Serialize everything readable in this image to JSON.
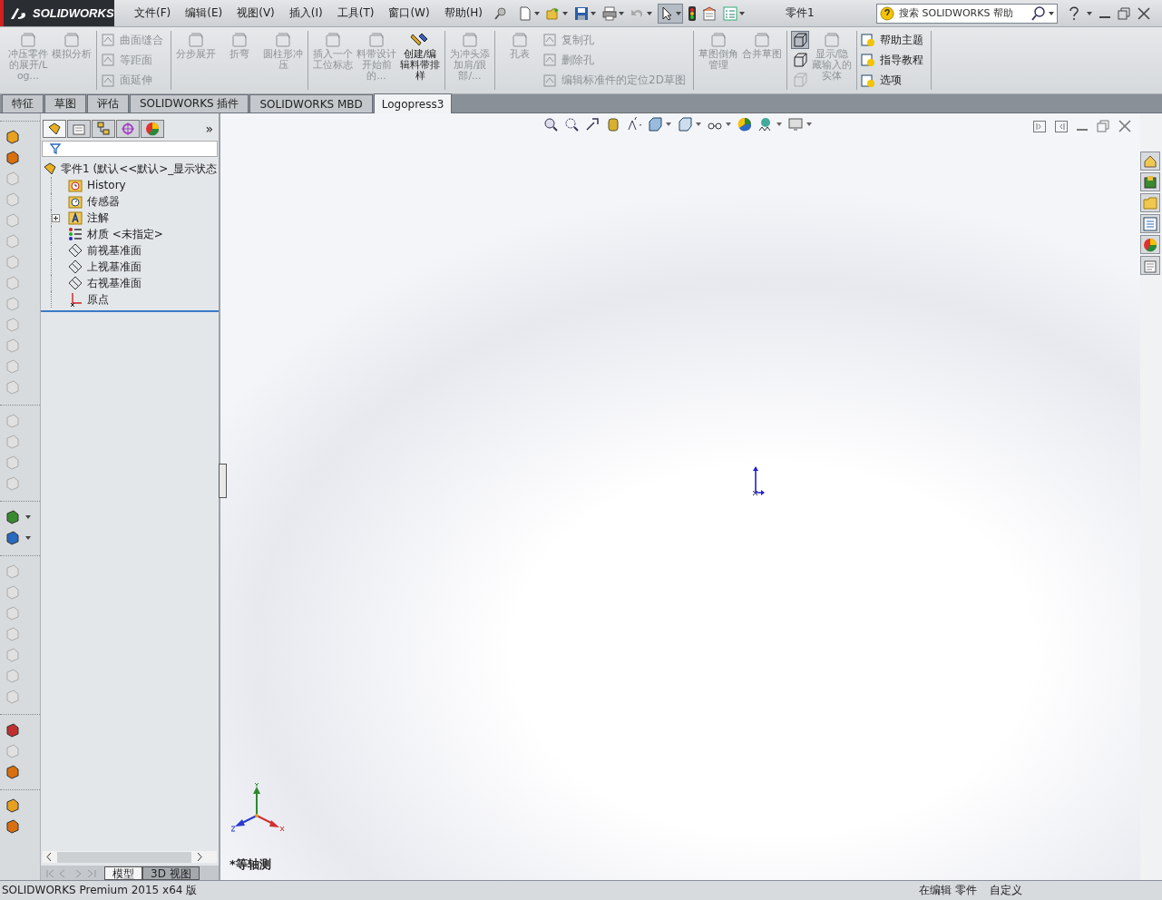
{
  "title_bar": {
    "logo": "SOLIDWORKS",
    "menu": [
      {
        "label": "文件(F)"
      },
      {
        "label": "编辑(E)"
      },
      {
        "label": "视图(V)"
      },
      {
        "label": "插入(I)"
      },
      {
        "label": "工具(T)"
      },
      {
        "label": "窗口(W)"
      },
      {
        "label": "帮助(H)"
      }
    ],
    "document_title": "零件1",
    "search": {
      "placeholder": "搜索 SOLIDWORKS 帮助"
    }
  },
  "ribbon": {
    "groups": [
      {
        "columns": [
          [
            {
              "kind": "large",
              "label": "冲压零件的展开/Log...",
              "disabled": true
            }
          ],
          [
            {
              "kind": "large",
              "label": "模拟分析",
              "disabled": true
            }
          ]
        ]
      },
      {
        "columns": [
          [
            {
              "kind": "small",
              "label": "曲面缝合",
              "disabled": true
            },
            {
              "kind": "small",
              "label": "等距面",
              "disabled": true
            },
            {
              "kind": "small",
              "label": "面延伸",
              "disabled": true
            }
          ]
        ]
      },
      {
        "columns": [
          [
            {
              "kind": "large",
              "label": "分步展开",
              "disabled": true
            }
          ],
          [
            {
              "kind": "large",
              "label": "折弯",
              "disabled": true
            }
          ],
          [
            {
              "kind": "large",
              "label": "圆柱形冲压",
              "disabled": true
            }
          ]
        ]
      },
      {
        "columns": [
          [
            {
              "kind": "large",
              "label": "插入一个工位标志",
              "disabled": true
            }
          ],
          [
            {
              "kind": "large",
              "label": "料带设计开始前的...",
              "disabled": true
            }
          ],
          [
            {
              "kind": "large",
              "label": "创建/编辑料带排样",
              "disabled": false
            }
          ]
        ]
      },
      {
        "columns": [
          [
            {
              "kind": "large",
              "label": "为冲头添加肩/跟部/...",
              "disabled": true
            }
          ]
        ]
      },
      {
        "columns": [
          [
            {
              "kind": "large",
              "label": "孔表",
              "disabled": true
            }
          ],
          [
            {
              "kind": "small",
              "label": "复制孔",
              "disabled": true
            },
            {
              "kind": "small",
              "label": "删除孔",
              "disabled": true
            },
            {
              "kind": "small",
              "label": "编辑标准件的定位2D草图",
              "disabled": true
            }
          ]
        ]
      },
      {
        "columns": [
          [
            {
              "kind": "large",
              "label": "草图倒角管理",
              "disabled": true
            }
          ],
          [
            {
              "kind": "large",
              "label": "合并草图",
              "disabled": true
            }
          ]
        ]
      },
      {
        "columns": [
          [
            {
              "kind": "icon",
              "selected": true,
              "disabled": false
            },
            {
              "kind": "icon",
              "selected": false,
              "disabled": false
            },
            {
              "kind": "icon",
              "selected": false,
              "disabled": true
            }
          ],
          [
            {
              "kind": "large",
              "label": "显示/隐藏输入的实体",
              "disabled": true
            }
          ]
        ]
      },
      {
        "columns": [
          [
            {
              "kind": "small",
              "label": "帮助主题",
              "disabled": false
            },
            {
              "kind": "small",
              "label": "指导教程",
              "disabled": false
            },
            {
              "kind": "small",
              "label": "选项",
              "disabled": false
            }
          ]
        ]
      }
    ]
  },
  "tabs": [
    {
      "label": "特征",
      "selected": false
    },
    {
      "label": "草图",
      "selected": false
    },
    {
      "label": "评估",
      "selected": false
    },
    {
      "label": "SOLIDWORKS 插件",
      "selected": false
    },
    {
      "label": "SOLIDWORKS MBD",
      "selected": false
    },
    {
      "label": "Logopress3",
      "selected": true
    }
  ],
  "left_toolbar": [
    [
      {
        "disabled": false,
        "dropdown": false
      },
      {
        "disabled": false,
        "dropdown": false
      },
      {
        "disabled": true,
        "dropdown": false
      },
      {
        "disabled": true,
        "dropdown": false
      },
      {
        "disabled": true,
        "dropdown": false
      },
      {
        "disabled": true,
        "dropdown": false
      },
      {
        "disabled": true,
        "dropdown": false
      },
      {
        "disabled": true,
        "dropdown": false
      },
      {
        "disabled": true,
        "dropdown": false
      },
      {
        "disabled": true,
        "dropdown": false
      },
      {
        "disabled": true,
        "dropdown": false
      },
      {
        "disabled": true,
        "dropdown": false
      },
      {
        "disabled": true,
        "dropdown": false
      }
    ],
    [
      {
        "disabled": true,
        "dropdown": false
      },
      {
        "disabled": true,
        "dropdown": false
      },
      {
        "disabled": true,
        "dropdown": false
      },
      {
        "disabled": true,
        "dropdown": false
      }
    ],
    [
      {
        "disabled": false,
        "dropdown": true
      },
      {
        "disabled": false,
        "dropdown": true
      }
    ],
    [
      {
        "disabled": true,
        "dropdown": false
      },
      {
        "disabled": true,
        "dropdown": false
      },
      {
        "disabled": true,
        "dropdown": false
      },
      {
        "disabled": true,
        "dropdown": false
      },
      {
        "disabled": true,
        "dropdown": false
      },
      {
        "disabled": true,
        "dropdown": false
      },
      {
        "disabled": true,
        "dropdown": false
      }
    ],
    [
      {
        "disabled": false,
        "dropdown": false
      },
      {
        "disabled": true,
        "dropdown": false
      },
      {
        "disabled": false,
        "dropdown": false
      }
    ],
    [
      {
        "disabled": false,
        "dropdown": false
      },
      {
        "disabled": false,
        "dropdown": false
      }
    ]
  ],
  "feature_manager": {
    "tabs": [
      {
        "selected": true
      },
      {
        "selected": false
      },
      {
        "selected": false
      },
      {
        "selected": false
      },
      {
        "selected": false
      }
    ],
    "more": "»",
    "tree": {
      "label": "零件1  (默认<<默认>_显示状态",
      "children": [
        {
          "kind": "history",
          "label": "History",
          "collapsed": false
        },
        {
          "kind": "sensor",
          "label": "传感器",
          "collapsed": false
        },
        {
          "kind": "annotation",
          "label": "注解",
          "collapsed": true
        },
        {
          "kind": "material",
          "label": "材质 <未指定>",
          "collapsed": false
        },
        {
          "kind": "plane",
          "label": "前视基准面",
          "collapsed": false
        },
        {
          "kind": "plane",
          "label": "上视基准面",
          "collapsed": false
        },
        {
          "kind": "plane",
          "label": "右视基准面",
          "collapsed": false
        },
        {
          "kind": "origin",
          "label": "原点",
          "collapsed": false
        }
      ]
    },
    "bottom_tabs": [
      {
        "label": "模型",
        "selected": true
      },
      {
        "label": "3D 视图",
        "selected": false
      }
    ]
  },
  "viewport": {
    "view_label": "*等轴测"
  },
  "status_bar": {
    "product": "SOLIDWORKS Premium 2015 x64 版",
    "mode": "在编辑 零件",
    "units": "自定义"
  }
}
